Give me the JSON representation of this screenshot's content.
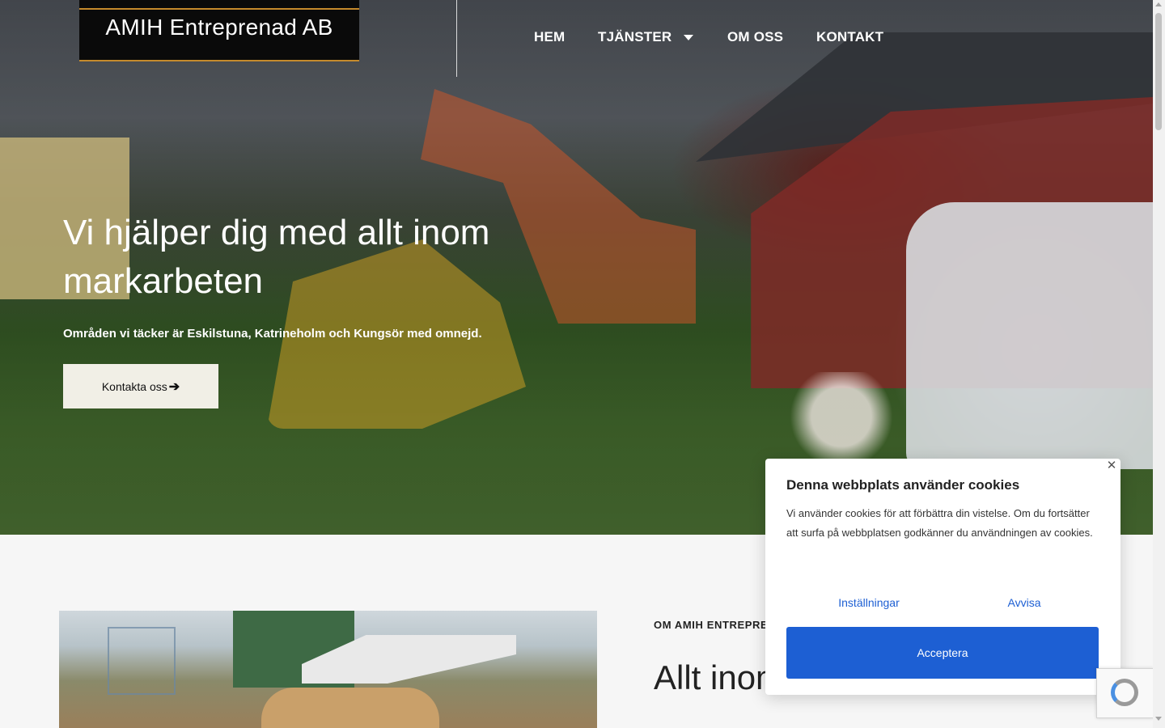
{
  "header": {
    "logo_text": "AMIH Entreprenad AB",
    "nav": {
      "home": "HEM",
      "services": "TJÄNSTER",
      "about": "OM OSS",
      "contact": "KONTAKT"
    }
  },
  "hero": {
    "headline": "Vi hjälper dig med allt inom markarbeten",
    "subline": "Områden vi täcker är Eskilstuna, Katrineholm och Kungsör med omnejd.",
    "cta_label": "Kontakta oss",
    "cta_arrow": "➔"
  },
  "about": {
    "eyebrow": "OM AMIH ENTREPRE",
    "title": "Allt inom"
  },
  "cookie": {
    "title": "Denna webbplats använder cookies",
    "body": "Vi använder cookies för att förbättra din vistelse. Om du fortsätter att surfa på webbplatsen godkänner du användningen av cookies.",
    "settings_label": "Inställningar",
    "reject_label": "Avvisa",
    "accept_label": "Acceptera",
    "close_glyph": "✕"
  },
  "colors": {
    "accent_blue": "#1d5fd3",
    "logo_gold": "#c58a2c",
    "cta_bg": "#f1efe6"
  }
}
